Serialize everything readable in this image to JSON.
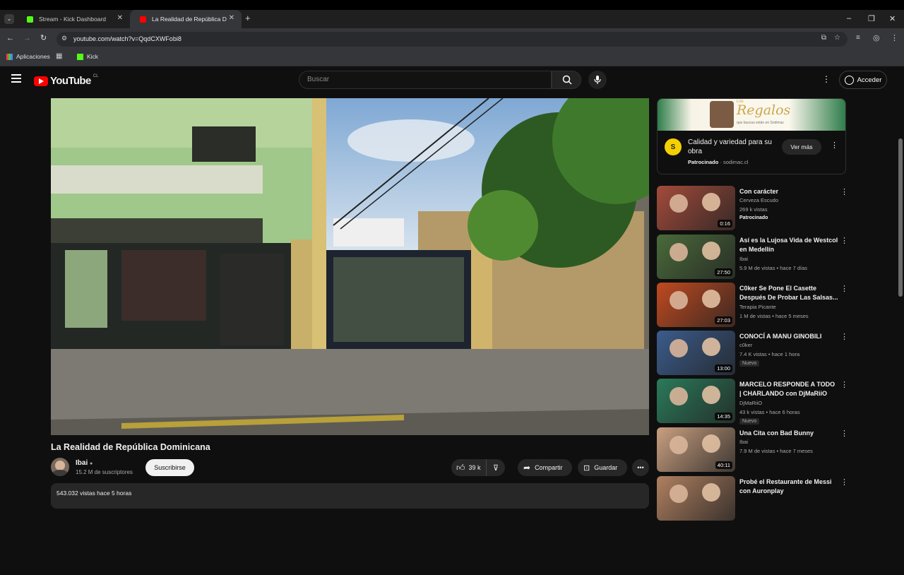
{
  "browser": {
    "tabs": [
      {
        "label": "Stream - Kick Dashboard",
        "active": false
      },
      {
        "label": "La Realidad de República D",
        "active": true
      }
    ],
    "url": "youtube.com/watch?v=QqdCXWFobi8",
    "bookmarks": [
      {
        "label": "Aplicaciones"
      },
      {
        "label": "Kick"
      }
    ]
  },
  "header": {
    "logo_text": "YouTube",
    "country": "CL",
    "search_placeholder": "Buscar",
    "signin_label": "Acceder"
  },
  "video": {
    "title": "La Realidad de República Dominicana",
    "channel": "Ibai",
    "subscribers": "15.2 M de suscriptores",
    "subscribe_label": "Suscribirse",
    "likes": "39 k",
    "share_label": "Compartir",
    "save_label": "Guardar",
    "description": "543.032 vistas  hace 5 horas"
  },
  "ad": {
    "banner_title": "Regalos",
    "banner_top": "Los",
    "banner_sub": "que buscas están en Sodimac",
    "title": "Calidad y variedad para su obra",
    "sponsored": "Patrocinado",
    "domain": "sodimac.cl",
    "button_label": "Ver más"
  },
  "recommendations": [
    {
      "title": "Con carácter",
      "channel": "Cerveza Escudo",
      "meta": "269 k vistas",
      "badge": "Patrocinado",
      "duration": "0:16",
      "thumb_color": "#a34b3b"
    },
    {
      "title": "Así es la Lujosa Vida de Westcol en Medellín",
      "channel": "Ibai",
      "meta": "5.9 M de vistas • hace 7 días",
      "duration": "27:50",
      "thumb_color": "#4a6a3a"
    },
    {
      "title": "C0ker Se Pone El Casette Después De Probar Las Salsas...",
      "channel": "Terapia Picante",
      "meta": "1 M de vistas • hace 5 meses",
      "duration": "27:03",
      "thumb_color": "#c04a20"
    },
    {
      "title": "CONOCÍ A MANU GINOBILI",
      "channel": "c0ker",
      "meta": "7.4 K vistas • hace 1 hora",
      "badge": "Nuevo",
      "duration": "13:00",
      "thumb_color": "#3b5c8c"
    },
    {
      "title": "MARCELO RESPONDE A TODO | CHARLANDO con DjMaRiiO",
      "channel": "DjMaRiiO",
      "meta": "43 k vistas • hace 6 horas",
      "badge": "Nuevo",
      "duration": "14:35",
      "thumb_color": "#2a7a5a"
    },
    {
      "title": "Una Cita con Bad Bunny",
      "channel": "Ibai",
      "meta": "7.9 M de vistas • hace 7 meses",
      "duration": "40:11",
      "thumb_color": "#c9a080"
    },
    {
      "title": "Probé el Restaurante de Messi con Auronplay",
      "channel": "",
      "meta": "",
      "duration": "",
      "thumb_color": "#b08060"
    }
  ]
}
